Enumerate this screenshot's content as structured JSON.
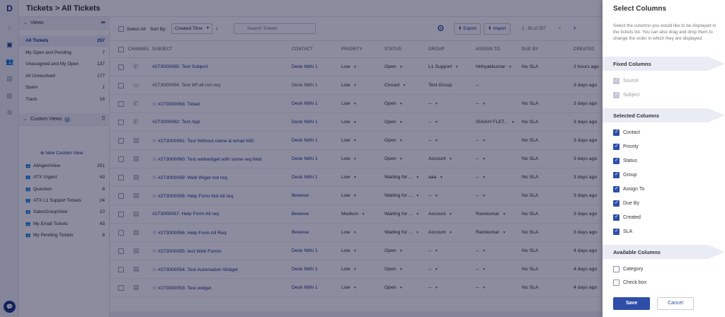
{
  "header": {
    "title": "Tickets > All Tickets"
  },
  "views": {
    "title": "Views",
    "items": [
      {
        "name": "All Tickets",
        "count": "257",
        "active": true
      },
      {
        "name": "My Open and Pending",
        "count": "7"
      },
      {
        "name": "Unassigned and My Open",
        "count": "137"
      },
      {
        "name": "All Unresolved",
        "count": "177"
      },
      {
        "name": "Spam",
        "count": "1"
      },
      {
        "name": "Trash",
        "count": "16"
      }
    ],
    "custom_title": "Custom Views",
    "new_custom_view": "New Custom View",
    "custom_items": [
      {
        "name": "AllAgentView",
        "count": "251"
      },
      {
        "name": "ATX Urgent",
        "count": "43"
      },
      {
        "name": "Question",
        "count": "8"
      },
      {
        "name": "ATX L1 Support Tickets",
        "count": "24"
      },
      {
        "name": "SalesGroupView",
        "count": "10"
      },
      {
        "name": "My Email Tickets",
        "count": "43"
      },
      {
        "name": "My Pending Tickets",
        "count": "6"
      }
    ]
  },
  "toolbar": {
    "select_all": "Select All",
    "sort_by": "Sort By:",
    "sort_value": "Created Time",
    "search_placeholder": "Search Tickets",
    "export": "Export",
    "import": "Import",
    "pagination": "1 - 50 of 257"
  },
  "table": {
    "headers": [
      "CHANNEL",
      "SUBJECT",
      "CONTACT",
      "PRIORITY",
      "STATUS",
      "GROUP",
      "ASSIGN TO",
      "DUE BY",
      "CREATED"
    ],
    "rows": [
      {
        "channel": "phone",
        "subject": "#273000065: Test Subject",
        "contact": "Desk Nithi 1",
        "priority": "Low",
        "status": "Open",
        "group": "L1 Support",
        "assign": "Nithyakkumar",
        "due": "No SLA",
        "created": "2 hours ago",
        "star": false
      },
      {
        "channel": "chat",
        "subject": "#273000064: Test Wf all not req",
        "contact": "Desk Nithi 1",
        "priority": "Low",
        "status": "Closed",
        "group": "Test Group",
        "assign": "--",
        "due": "",
        "created": "3 days ago",
        "star": false,
        "plain": true
      },
      {
        "channel": "phone",
        "subject": "#273000063: Ticket",
        "contact": "Desk Nithi 1",
        "priority": "Low",
        "status": "Open",
        "group": "--",
        "assign": "--",
        "due": "No SLA",
        "created": "3 days ago",
        "star": true
      },
      {
        "channel": "phone",
        "subject": "#273000062: Test App",
        "contact": "Desk Nithi 1",
        "priority": "Low",
        "status": "Open",
        "group": "--",
        "assign": "ISAIAH FLET...",
        "due": "No SLA",
        "created": "3 days ago",
        "star": false
      },
      {
        "channel": "form",
        "subject": "#273000061: Test Without name & email WD",
        "contact": "Desk Nithi 1",
        "priority": "Low",
        "status": "Open",
        "group": "--",
        "assign": "--",
        "due": "No SLA",
        "created": "3 days ago",
        "star": true
      },
      {
        "channel": "form",
        "subject": "#273000060: Test webwidget with some req field",
        "contact": "Desk Nithi 1",
        "priority": "Low",
        "status": "Open",
        "group": "Account",
        "assign": "--",
        "due": "No SLA",
        "created": "3 days ago",
        "star": true
      },
      {
        "channel": "form",
        "subject": "#273000059: Web Wiget not req",
        "contact": "Desk Nithi 1",
        "priority": "Low",
        "status": "Waiting for ...",
        "group": "aaa",
        "assign": "--",
        "due": "No SLA",
        "created": "3 days ago",
        "star": true
      },
      {
        "channel": "form",
        "subject": "#273000058: Help Form Not All req",
        "contact": "Beweve",
        "priority": "Low",
        "status": "Waiting for ...",
        "group": "--",
        "assign": "--",
        "due": "No SLA",
        "created": "3 days ago",
        "star": true
      },
      {
        "channel": "form",
        "subject": "#273000057: Help Form All req",
        "contact": "Beweve",
        "priority": "Medium",
        "status": "Waiting for ...",
        "group": "Account",
        "assign": "Ramkumar",
        "due": "No SLA",
        "created": "3 days ago",
        "star": false
      },
      {
        "channel": "form",
        "subject": "#273000056: Help Form All Req",
        "contact": "Beweve",
        "priority": "Low",
        "status": "Waiting for ...",
        "group": "Account",
        "assign": "Ramkumar",
        "due": "No SLA",
        "created": "3 days ago",
        "star": true
      },
      {
        "channel": "form",
        "subject": "#273000055: test Web Formn",
        "contact": "Desk Nithi 1",
        "priority": "Low",
        "status": "Open",
        "group": "--",
        "assign": "--",
        "due": "No SLA",
        "created": "4 days ago",
        "star": true
      },
      {
        "channel": "form",
        "subject": "#273000054: Test Automation Widget",
        "contact": "Desk Nithi 1",
        "priority": "Low",
        "status": "Open",
        "group": "--",
        "assign": "--",
        "due": "No SLA",
        "created": "4 days ago",
        "star": true
      },
      {
        "channel": "form",
        "subject": "#273000053: Test widget",
        "contact": "Desk Nithi 1",
        "priority": "Low",
        "status": "Open",
        "group": "--",
        "assign": "--",
        "due": "No SLA",
        "created": "4 days ago",
        "star": true
      }
    ]
  },
  "panel": {
    "title": "Select Columns",
    "description": "Select the columns you would like to be displayed in the tickets list. You can also drag and drop them to change the order in which they are displayed.",
    "fixed_title": "Fixed Columns",
    "fixed": [
      "Source",
      "Subject"
    ],
    "selected_title": "Selected Columns",
    "selected": [
      "Contact",
      "Priority",
      "Status",
      "Group",
      "Assign To",
      "Due By",
      "Created",
      "SLA"
    ],
    "available_title": "Available Columns",
    "available": [
      "Category",
      "Check box"
    ],
    "save": "Save",
    "cancel": "Cancel"
  }
}
